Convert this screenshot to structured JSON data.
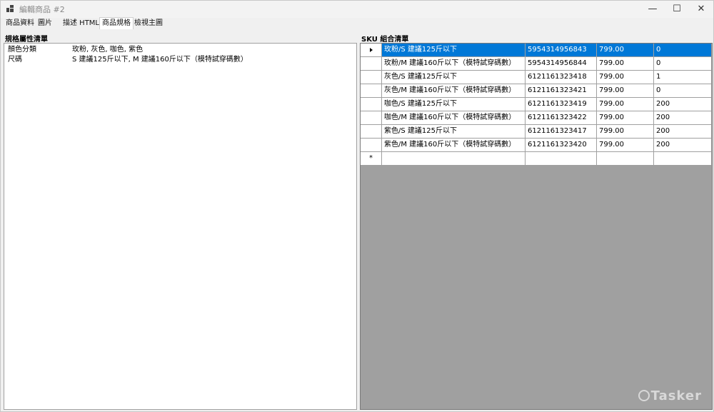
{
  "window": {
    "title": "編輯商品 #2",
    "controls": {
      "minimize": "—",
      "maximize": "☐",
      "close": "✕"
    }
  },
  "tabs": [
    {
      "label": "商品資料",
      "active": false
    },
    {
      "label": "圖片",
      "active": false
    },
    {
      "label": "描述 HTML",
      "active": false
    },
    {
      "label": "商品規格",
      "active": true
    },
    {
      "label": "檢視主圖",
      "active": false
    }
  ],
  "spec_panel": {
    "label": "規格屬性清單",
    "rows": [
      {
        "name": "顏色分類",
        "value": "玫粉, 灰色, 咖色, 紫色"
      },
      {
        "name": "尺碼",
        "value": "S 建議125斤以下, M 建議160斤以下（模特試穿碼數）"
      }
    ]
  },
  "sku_panel": {
    "label": "SKU 組合清單",
    "new_row_marker": "*",
    "rows": [
      {
        "name": "玫粉/S 建議125斤以下",
        "barcode": "5954314956843",
        "price": "799.00",
        "stock": "0",
        "selected": true
      },
      {
        "name": "玫粉/M 建議160斤以下（模特試穿碼數）",
        "barcode": "5954314956844",
        "price": "799.00",
        "stock": "0",
        "selected": false
      },
      {
        "name": "灰色/S 建議125斤以下",
        "barcode": "6121161323418",
        "price": "799.00",
        "stock": "1",
        "selected": false
      },
      {
        "name": "灰色/M 建議160斤以下（模特試穿碼數）",
        "barcode": "6121161323421",
        "price": "799.00",
        "stock": "0",
        "selected": false
      },
      {
        "name": "咖色/S 建議125斤以下",
        "barcode": "6121161323419",
        "price": "799.00",
        "stock": "200",
        "selected": false
      },
      {
        "name": "咖色/M 建議160斤以下（模特試穿碼數）",
        "barcode": "6121161323422",
        "price": "799.00",
        "stock": "200",
        "selected": false
      },
      {
        "name": "紫色/S 建議125斤以下",
        "barcode": "6121161323417",
        "price": "799.00",
        "stock": "200",
        "selected": false
      },
      {
        "name": "紫色/M 建議160斤以下（模特試穿碼數）",
        "barcode": "6121161323420",
        "price": "799.00",
        "stock": "200",
        "selected": false
      }
    ]
  },
  "watermark": {
    "text": "Tasker",
    "icon": "tasker-logo-icon"
  },
  "colors": {
    "selection": "#0078d7",
    "grid_background": "#a0a0a0"
  }
}
